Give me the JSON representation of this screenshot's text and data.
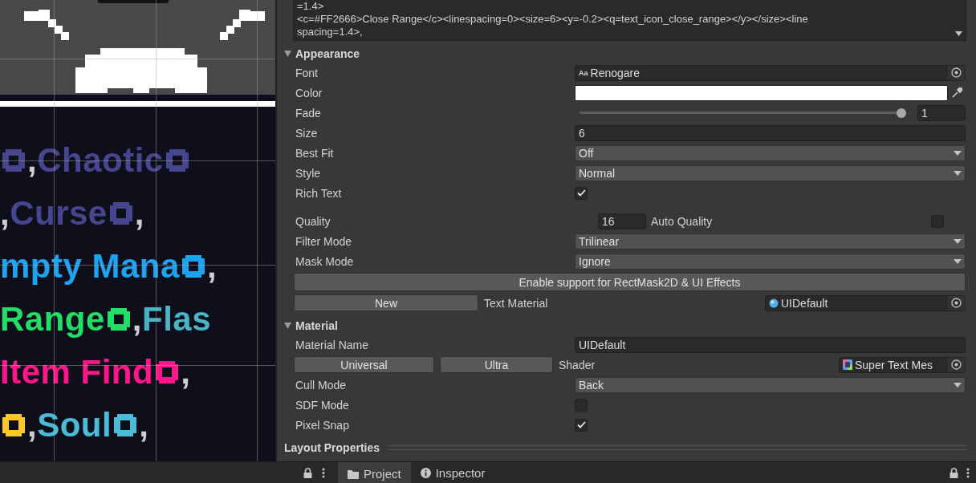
{
  "scene": {
    "lines": [
      {
        "parts": [
          {
            "kind": "icon",
            "color": "#46468f"
          },
          {
            "kind": "word",
            "text": ",",
            "color": "#cfcfcf"
          },
          {
            "kind": "word",
            "text": "Chaotic",
            "color": "#46468f"
          },
          {
            "kind": "icon",
            "color": "#46468f"
          }
        ]
      },
      {
        "parts": [
          {
            "kind": "word",
            "text": ",",
            "color": "#cfcfcf"
          },
          {
            "kind": "word",
            "text": "Curse",
            "color": "#46468f"
          },
          {
            "kind": "icon",
            "color": "#46468f"
          },
          {
            "kind": "word",
            "text": ",",
            "color": "#cfcfcf"
          }
        ]
      },
      {
        "parts": [
          {
            "kind": "word",
            "text": "mpty Mana",
            "color": "#1ea3ee"
          },
          {
            "kind": "icon",
            "color": "#1ea3ee"
          },
          {
            "kind": "word",
            "text": ",",
            "color": "#cfcfcf"
          }
        ]
      },
      {
        "parts": [
          {
            "kind": "word",
            "text": "Range",
            "color": "#22dd66"
          },
          {
            "kind": "icon",
            "color": "#22dd66"
          },
          {
            "kind": "word",
            "text": ",",
            "color": "#cfcfcf"
          },
          {
            "kind": "word",
            "text": "Flas",
            "color": "#4ab4c4"
          }
        ]
      },
      {
        "parts": [
          {
            "kind": "word",
            "text": "Item Find",
            "color": "#ff168a"
          },
          {
            "kind": "icon",
            "color": "#ff168a"
          },
          {
            "kind": "word",
            "text": ",",
            "color": "#cfcfcf"
          }
        ]
      },
      {
        "parts": [
          {
            "kind": "icon",
            "color": "#ffc824"
          },
          {
            "kind": "word",
            "text": ",",
            "color": "#cfcfcf"
          },
          {
            "kind": "word",
            "text": "Soul",
            "color": "#4abcd6"
          },
          {
            "kind": "icon",
            "color": "#4abcd6"
          },
          {
            "kind": "word",
            "text": ",",
            "color": "#cfcfcf"
          }
        ]
      }
    ]
  },
  "inspector": {
    "code_lines": [
      "=1.4>",
      "<c=#FF2666>Close Range</c><linespacing=0><size=6><y=-0.2><q=text_icon_close_range></y></size><line",
      "spacing=1.4>,"
    ],
    "sections": [
      {
        "title": "Appearance",
        "expanded": true,
        "rows": [
          {
            "kind": "object",
            "label": "Font",
            "icon_text": "Aa",
            "value": "Renogare"
          },
          {
            "kind": "color",
            "label": "Color",
            "color": "#ffffff"
          },
          {
            "kind": "slider",
            "label": "Fade",
            "level": 1,
            "reading": "1"
          },
          {
            "kind": "text",
            "label": "Size",
            "value": "6"
          },
          {
            "kind": "dropdown",
            "label": "Best Fit",
            "value": "Off"
          },
          {
            "kind": "dropdown",
            "label": "Style",
            "value": "Normal"
          },
          {
            "kind": "checkbox",
            "label": "Rich Text",
            "checked": true
          },
          {
            "kind": "quality",
            "label": "Quality",
            "value": "16",
            "toggle_label": "Auto Quality",
            "checked": false
          },
          {
            "kind": "dropdown",
            "label": "Filter Mode",
            "value": "Trilinear"
          },
          {
            "kind": "dropdown",
            "label": "Mask Mode",
            "value": "Ignore"
          },
          {
            "kind": "wide-button",
            "label": "Enable support for RectMask2D & UI Effects"
          },
          {
            "kind": "material",
            "buttons": [
              "New"
            ],
            "label": "Text Material",
            "value": "UIDefault"
          }
        ]
      },
      {
        "title": "Material",
        "expanded": true,
        "rows": [
          {
            "kind": "text",
            "label": "Material Name",
            "value": "UIDefault"
          },
          {
            "kind": "shader",
            "buttons": [
              "Universal",
              "Ultra"
            ],
            "label": "Shader",
            "value": "Super Text Mes"
          },
          {
            "kind": "dropdown",
            "label": "Cull Mode",
            "value": "Back"
          },
          {
            "kind": "checkbox",
            "label": "SDF Mode",
            "checked": false
          },
          {
            "kind": "checkbox",
            "label": "Pixel Snap",
            "checked": true
          }
        ]
      },
      {
        "title": "Layout Properties",
        "expanded": false
      }
    ]
  },
  "tabs": [
    {
      "label": "Project",
      "selected": true
    },
    {
      "label": "Inspector",
      "selected": false
    }
  ]
}
